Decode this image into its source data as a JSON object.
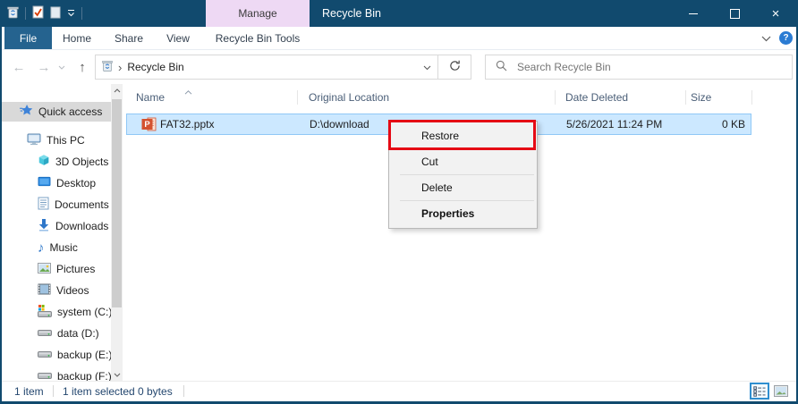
{
  "window": {
    "title": "Recycle Bin",
    "close_glyph": "×"
  },
  "quick_access_toolbar": {
    "icons": [
      "recycle-bin-icon",
      "properties-check-icon",
      "new-folder-icon",
      "customize-chevron-icon"
    ]
  },
  "ribbon": {
    "contextual_group_label": "Manage",
    "tabs": [
      "File",
      "Home",
      "Share",
      "View",
      "Recycle Bin Tools"
    ],
    "active_tab": "File",
    "help_glyph": "?"
  },
  "address_bar": {
    "location": "Recycle Bin",
    "breadcrumb_chevron": "›",
    "back_glyph": "←",
    "forward_glyph": "→",
    "up_glyph": "↑",
    "search_placeholder": "Search Recycle Bin"
  },
  "sidebar": {
    "items": [
      {
        "label": "Quick access",
        "icon": "star-icon",
        "selected": true
      },
      {
        "label": "This PC",
        "icon": "computer-icon"
      },
      {
        "label": "3D Objects",
        "icon": "cube-icon"
      },
      {
        "label": "Desktop",
        "icon": "desktop-icon"
      },
      {
        "label": "Documents",
        "icon": "document-icon"
      },
      {
        "label": "Downloads",
        "icon": "download-icon"
      },
      {
        "label": "Music",
        "icon": "music-note-icon",
        "glyph": "♪"
      },
      {
        "label": "Pictures",
        "icon": "picture-icon"
      },
      {
        "label": "Videos",
        "icon": "film-icon"
      },
      {
        "label": "system (C:)",
        "icon": "system-drive-icon"
      },
      {
        "label": "data (D:)",
        "icon": "drive-icon"
      },
      {
        "label": "backup (E:)",
        "icon": "drive-icon"
      },
      {
        "label": "backup (F:)",
        "icon": "drive-icon",
        "clipped": true
      }
    ]
  },
  "file_list": {
    "columns": [
      "Name",
      "Original Location",
      "Date Deleted",
      "Size"
    ],
    "sort_column": "Name",
    "rows": [
      {
        "name": "FAT32.pptx",
        "icon": "powerpoint-file-icon",
        "original_location": "D:\\download",
        "date_deleted": "5/26/2021 11:24 PM",
        "size": "0 KB",
        "selected": true
      }
    ]
  },
  "context_menu": {
    "items": [
      {
        "label": "Restore",
        "annotated": true
      },
      {
        "label": "Cut"
      },
      {
        "label": "Delete"
      },
      {
        "label": "Properties",
        "bold": true
      }
    ]
  },
  "status_bar": {
    "item_count": "1 item",
    "selection_count": "1 item selected",
    "selection_size": "0 bytes"
  },
  "colors": {
    "titlebar": "#114a6e",
    "file_tab": "#25638f",
    "manage_tab": "#eed9f4",
    "selection_fill": "#cce8ff",
    "selection_border": "#90c8f6",
    "annotation_red": "#e50914",
    "status_text": "#24476f"
  }
}
